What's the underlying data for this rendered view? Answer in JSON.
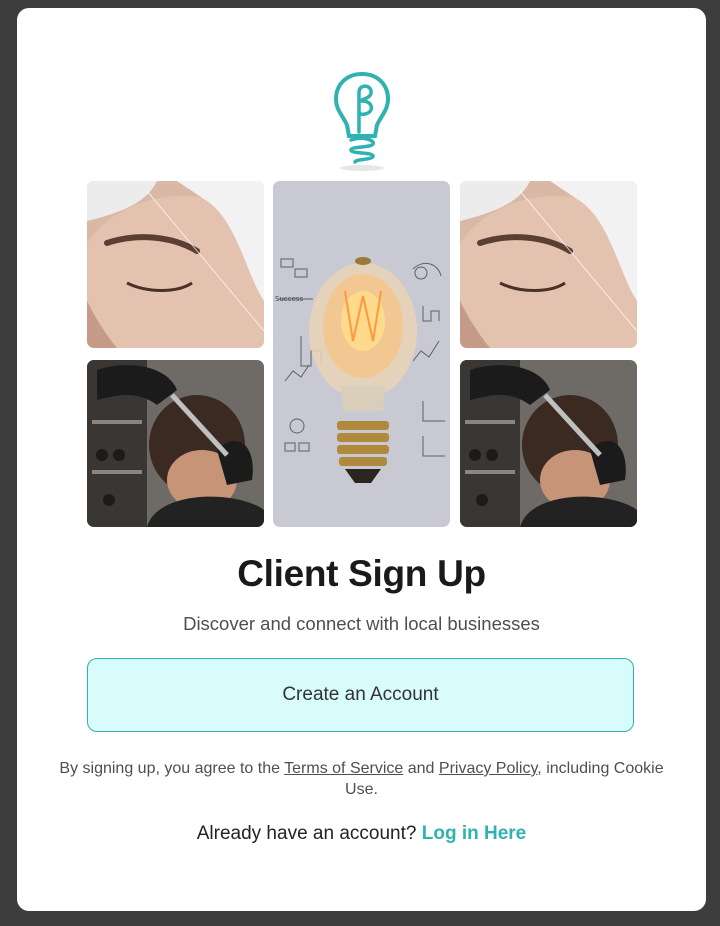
{
  "logo": {
    "icon": "lightbulb-logo-icon",
    "color": "#2fb2b0"
  },
  "gallery": {
    "images": [
      {
        "name": "eyebrow-threading-photo-left"
      },
      {
        "name": "barber-haircut-photo-left"
      },
      {
        "name": "lightbulb-ideas-photo"
      },
      {
        "name": "eyebrow-threading-photo-right"
      },
      {
        "name": "barber-haircut-photo-right"
      }
    ]
  },
  "page": {
    "title": "Client Sign Up",
    "subtitle": "Discover and connect with local businesses"
  },
  "cta": {
    "label": "Create an Account",
    "accent": "#2fb2b0",
    "background": "#d7fcfb"
  },
  "legal": {
    "prefix": "By signing up, you agree to the",
    "terms_link": "Terms of Service",
    "and": "and",
    "privacy_link": "Privacy Policy",
    "suffix": ", including Cookie Use."
  },
  "login": {
    "prompt": "Already have an account?",
    "link": "Log in Here"
  }
}
